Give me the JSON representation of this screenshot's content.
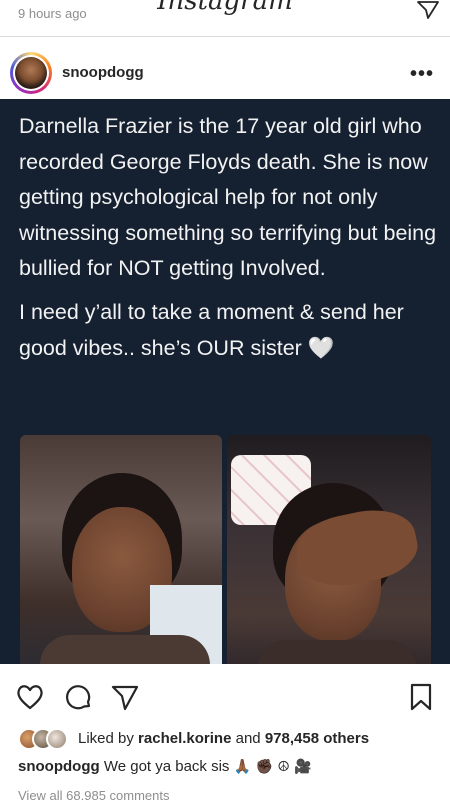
{
  "top_bar": {
    "app_logo": "Instagram",
    "previous_post_time": "9 hours ago"
  },
  "post": {
    "username": "snoopdogg",
    "more_label": "•••",
    "image_text": {
      "paragraph1": "Darnella Frazier is the 17 year old girl who recorded George Floyds death. She is now getting psychological help for not only witnessing something so terrifying but being bullied for NOT getting Involved.",
      "paragraph2": "I need y’all to take a moment & send her good vibes.. she’s OUR sister",
      "heart": "🤍"
    }
  },
  "actions": {
    "like": "heart-icon",
    "comment": "comment-icon",
    "share": "send-icon",
    "save": "bookmark-icon"
  },
  "likes": {
    "prefix": "Liked by ",
    "user": "rachel.korine",
    "middle": " and ",
    "count": "978,458 others"
  },
  "caption": {
    "user": "snoopdogg",
    "text": " We got ya back sis",
    "emojis": "🙏🏾 ✊🏿 ☮ 🎥"
  },
  "views": {
    "text": "View all 68,985 comments"
  }
}
